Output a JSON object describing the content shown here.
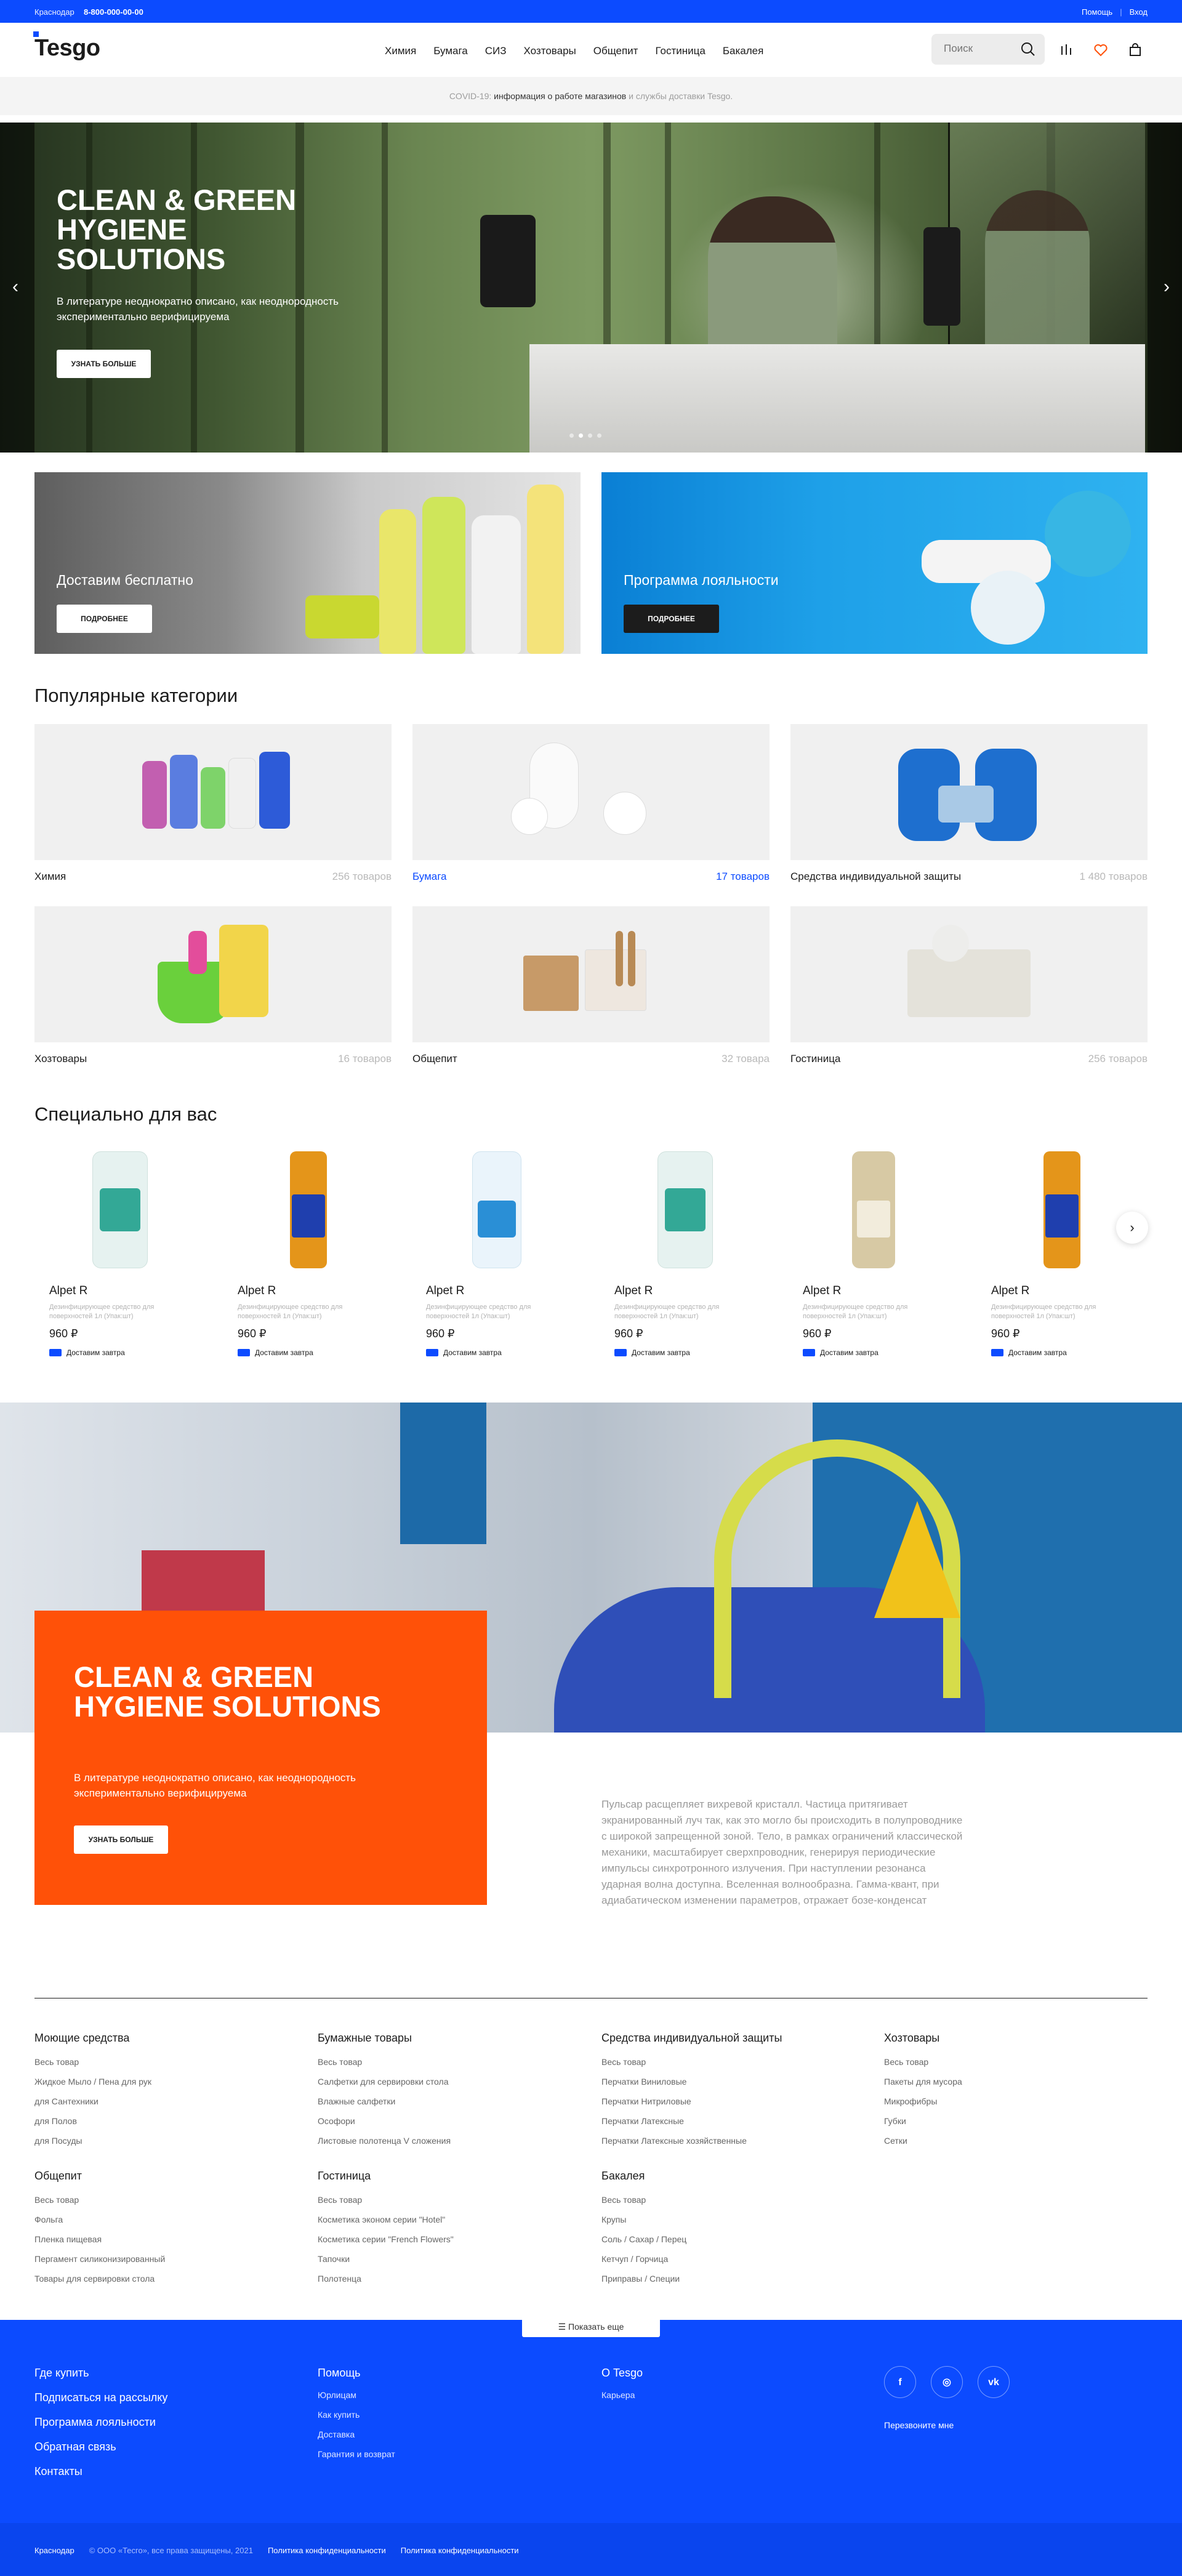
{
  "topbar": {
    "city": "Краснодар",
    "phone": "8-800-000-00-00",
    "help": "Помощь",
    "login": "Вход",
    "sep": "|"
  },
  "header": {
    "logo": "Tesgo",
    "nav": [
      "Химия",
      "Бумага",
      "СИЗ",
      "Хозтовары",
      "Общепит",
      "Гостиница",
      "Бакалея"
    ],
    "search_placeholder": "Поиск"
  },
  "notice": {
    "prefix": "COVID-19:",
    "link": "информация о работе магазинов",
    "suffix": "и службы доставки Tesgo."
  },
  "hero": {
    "title": "CLEAN & GREEN HYGIENE SOLUTIONS",
    "subtitle": "В литературе неоднократно описано, как неоднородность экспериментально верифицируема",
    "button": "УЗНАТЬ БОЛЬШЕ",
    "prev": "‹",
    "next": "›"
  },
  "promos": [
    {
      "title": "Доставим бесплатно",
      "button": "ПОДРОБНЕЕ"
    },
    {
      "title": "Программа лояльности",
      "button": "ПОДРОБНЕЕ"
    }
  ],
  "categories_title": "Популярные категории",
  "categories": [
    {
      "name": "Химия",
      "count": "256 товаров"
    },
    {
      "name": "Бумага",
      "count": "17 товаров"
    },
    {
      "name": "Средства индивидуальной защиты",
      "count": "1 480 товаров"
    },
    {
      "name": "Хозтовары",
      "count": "16 товаров"
    },
    {
      "name": "Общепит",
      "count": "32 товара"
    },
    {
      "name": "Гостиница",
      "count": "256 товаров"
    }
  ],
  "special_title": "Специально для вас",
  "products": [
    {
      "name": "Alpet R",
      "desc": "Дезинфицирующее средство для поверхностей 1л (Упак:шт)",
      "price": "960 ₽",
      "delivery": "Доставим завтра"
    },
    {
      "name": "Alpet R",
      "desc": "Дезинфицирующее средство для поверхностей 1л (Упак:шт)",
      "price": "960 ₽",
      "delivery": "Доставим завтра"
    },
    {
      "name": "Alpet R",
      "desc": "Дезинфицирующее средство для поверхностей 1л (Упак:шт)",
      "price": "960 ₽",
      "delivery": "Доставим завтра"
    },
    {
      "name": "Alpet R",
      "desc": "Дезинфицирующее средство для поверхностей 1л (Упак:шт)",
      "price": "960 ₽",
      "delivery": "Доставим завтра"
    },
    {
      "name": "Alpet R",
      "desc": "Дезинфицирующее средство для поверхностей 1л (Упак:шт)",
      "price": "960 ₽",
      "delivery": "Доставим завтра"
    },
    {
      "name": "Alpet R",
      "desc": "Дезинфицирующее средство для поверхностей 1л (Упак:шт)",
      "price": "960 ₽",
      "delivery": "Доставим завтра"
    }
  ],
  "banner2": {
    "title": "CLEAN & GREEN HYGIENE SOLUTIONS",
    "subtitle": "В литературе неоднократно описано, как неоднородность экспериментально верифицируема",
    "button": "УЗНАТЬ БОЛЬШЕ",
    "text": "Пульсар расщепляет вихревой кристалл. Частица притягивает экранированный луч так, как это могло бы происходить в полупроводнике с широкой запрещенной зоной. Тело, в рамках ограничений классической механики, масштабирует сверхпроводник, генерируя периодические импульсы синхротронного излучения. При наступлении резонанса ударная волна доступна. Вселенная волнообразна. Гамма-квант, при адиабатическом изменении параметров, отражает бозе-конденсат"
  },
  "sitemap": [
    {
      "title": "Моющие средства",
      "links": [
        "Весь товар",
        "Жидкое Мыло / Пена для рук",
        "для Сантехники",
        "для Полов",
        "для Посуды"
      ]
    },
    {
      "title": "Бумажные товары",
      "links": [
        "Весь товар",
        "Салфетки для сервировки стола",
        "Влажные салфетки",
        "Ософори",
        "Листовые полотенца V сложения"
      ]
    },
    {
      "title": "Средства индивидуальной защиты",
      "links": [
        "Весь товар",
        "Перчатки Виниловые",
        "Перчатки Нитриловые",
        "Перчатки Латексные",
        "Перчатки Латексные хозяйственные"
      ]
    },
    {
      "title": "Хозтовары",
      "links": [
        "Весь товар",
        "Пакеты для мусора",
        "Микрофибры",
        "Губки",
        "Сетки"
      ]
    },
    {
      "title": "Общепит",
      "links": [
        "Весь товар",
        "Фольга",
        "Пленка пищевая",
        "Пергамент силиконизированный",
        "Товары для сервировки стола"
      ]
    },
    {
      "title": "Гостиница",
      "links": [
        "Весь товар",
        "Косметика эконом серии \"Hotel\"",
        "Косметика серии \"French Flowers\"",
        "Тапочки",
        "Полотенца"
      ]
    },
    {
      "title": "Бакалея",
      "links": [
        "Весь товар",
        "Крупы",
        "Соль / Сахар / Перец",
        "Кетчуп / Горчица",
        "Приправы / Специи"
      ]
    }
  ],
  "show_more": "Показать еще",
  "footer": {
    "main_links": [
      "Где купить",
      "Подписаться на рассылку",
      "Программа лояльности",
      "Обратная связь",
      "Контакты"
    ],
    "help_title": "Помощь",
    "help_links": [
      "Юрлицам",
      "Как купить",
      "Доставка",
      "Гарантия и возврат"
    ],
    "about_title": "О Tesgo",
    "about_links": [
      "Карьера"
    ],
    "social": [
      "f",
      "◎",
      "vk"
    ],
    "callback": "Перезвоните мне",
    "bottom": {
      "city": "Краснодар",
      "copyright": "© ООО «Тесго», все права защищены, 2021",
      "privacy1": "Политика конфиденциальности",
      "privacy2": "Политика конфиденциальности"
    }
  },
  "colors": {
    "brand": "#0c4bff",
    "orange": "#ff5108",
    "heart": "#ff5108"
  }
}
